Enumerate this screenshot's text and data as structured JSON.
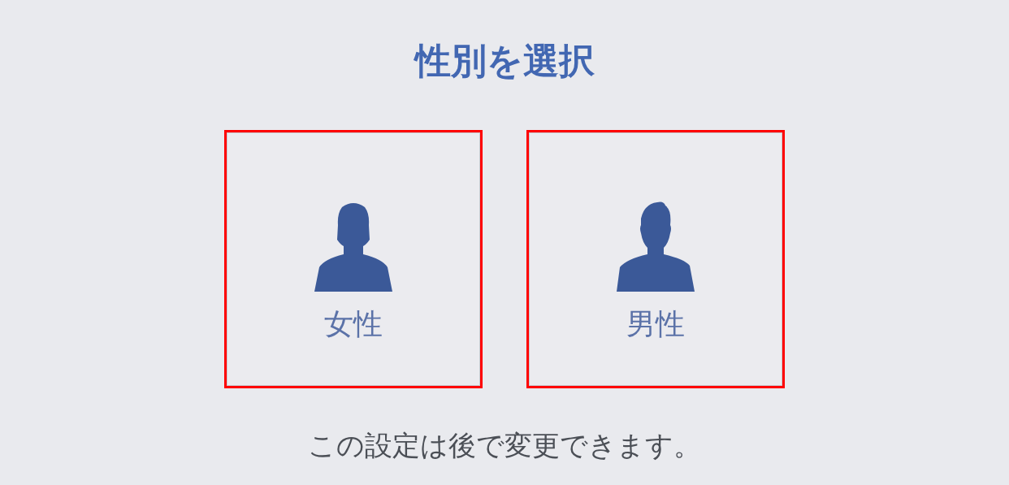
{
  "title": "性別を選択",
  "options": [
    {
      "kind": "female",
      "label": "女性",
      "highlighted": true
    },
    {
      "kind": "male",
      "label": "男性",
      "highlighted": true
    }
  ],
  "note": "この設定は後で変更できます。"
}
